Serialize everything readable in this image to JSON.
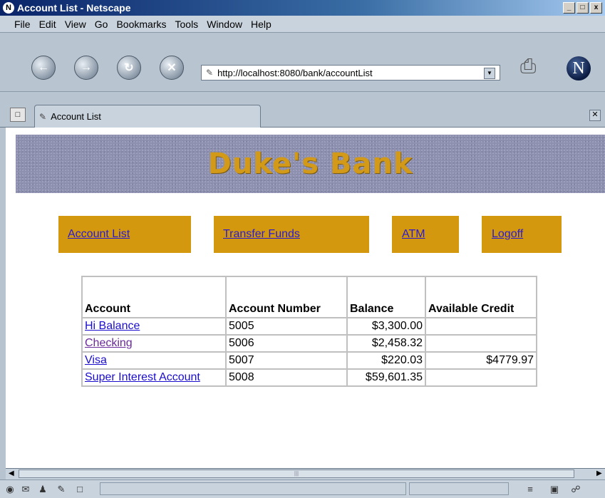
{
  "window": {
    "title": "Account List - Netscape",
    "controls": [
      "_",
      "□",
      "x"
    ]
  },
  "menu": [
    "File",
    "Edit",
    "View",
    "Go",
    "Bookmarks",
    "Tools",
    "Window",
    "Help"
  ],
  "address_bar": {
    "url": "http://localhost:8080/bank/accountList"
  },
  "tab": {
    "label": "Account List"
  },
  "page": {
    "banner_title": "Duke's Bank",
    "nav_links": [
      "Account List",
      "Transfer Funds",
      "ATM",
      "Logoff"
    ],
    "table": {
      "headers": [
        "Account",
        "Account Number",
        "Balance",
        "Available Credit"
      ],
      "rows": [
        {
          "account": "Hi Balance",
          "number": "5005",
          "balance": "$3,300.00",
          "credit": ""
        },
        {
          "account": "Checking",
          "number": "5006",
          "balance": "$2,458.32",
          "credit": ""
        },
        {
          "account": "Visa",
          "number": "5007",
          "balance": "$220.03",
          "credit": "$4779.97"
        },
        {
          "account": "Super Interest Account",
          "number": "5008",
          "balance": "$59,601.35",
          "credit": ""
        }
      ]
    }
  },
  "colors": {
    "nav_link_bg": "#d4980f",
    "banner_text": "#d29a18",
    "link": "#1a0dcc",
    "visited_link": "#6a2a9a"
  }
}
